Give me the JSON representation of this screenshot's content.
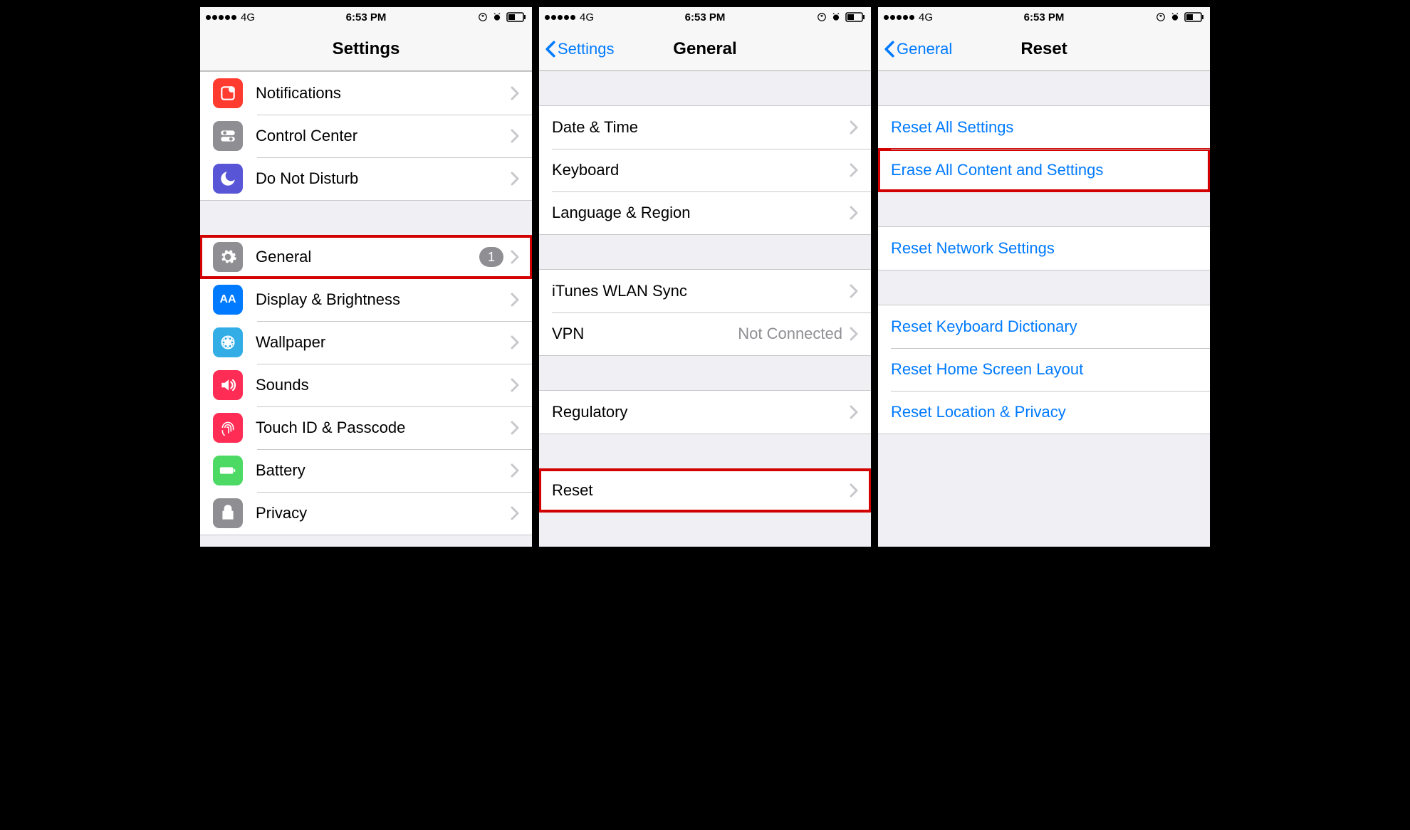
{
  "status": {
    "carrier": "4G",
    "time": "6:53 PM"
  },
  "screen1": {
    "title": "Settings",
    "group1": [
      {
        "label": "Notifications",
        "icon": "notifications-icon",
        "bg": "bg-red"
      },
      {
        "label": "Control Center",
        "icon": "control-center-icon",
        "bg": "bg-gray"
      },
      {
        "label": "Do Not Disturb",
        "icon": "dnd-icon",
        "bg": "bg-purple"
      }
    ],
    "group2": [
      {
        "label": "General",
        "icon": "gear-icon",
        "bg": "bg-gray",
        "badge": "1",
        "highlight": true
      },
      {
        "label": "Display & Brightness",
        "icon": "display-icon",
        "bg": "bg-blue"
      },
      {
        "label": "Wallpaper",
        "icon": "wallpaper-icon",
        "bg": "bg-cyan"
      },
      {
        "label": "Sounds",
        "icon": "sounds-icon",
        "bg": "bg-pink"
      },
      {
        "label": "Touch ID & Passcode",
        "icon": "fingerprint-icon",
        "bg": "bg-pink"
      },
      {
        "label": "Battery",
        "icon": "battery-icon",
        "bg": "bg-green"
      },
      {
        "label": "Privacy",
        "icon": "privacy-icon",
        "bg": "bg-gray"
      }
    ]
  },
  "screen2": {
    "back": "Settings",
    "title": "General",
    "group1": [
      {
        "label": "Date & Time"
      },
      {
        "label": "Keyboard"
      },
      {
        "label": "Language & Region"
      }
    ],
    "group2": [
      {
        "label": "iTunes WLAN Sync"
      },
      {
        "label": "VPN",
        "detail": "Not Connected"
      }
    ],
    "group3": [
      {
        "label": "Regulatory"
      }
    ],
    "group4": [
      {
        "label": "Reset",
        "highlight": true
      }
    ]
  },
  "screen3": {
    "back": "General",
    "title": "Reset",
    "group1": [
      {
        "label": "Reset All Settings"
      },
      {
        "label": "Erase All Content and Settings",
        "highlight": true
      }
    ],
    "group2": [
      {
        "label": "Reset Network Settings"
      }
    ],
    "group3": [
      {
        "label": "Reset Keyboard Dictionary"
      },
      {
        "label": "Reset Home Screen Layout"
      },
      {
        "label": "Reset Location & Privacy"
      }
    ]
  }
}
